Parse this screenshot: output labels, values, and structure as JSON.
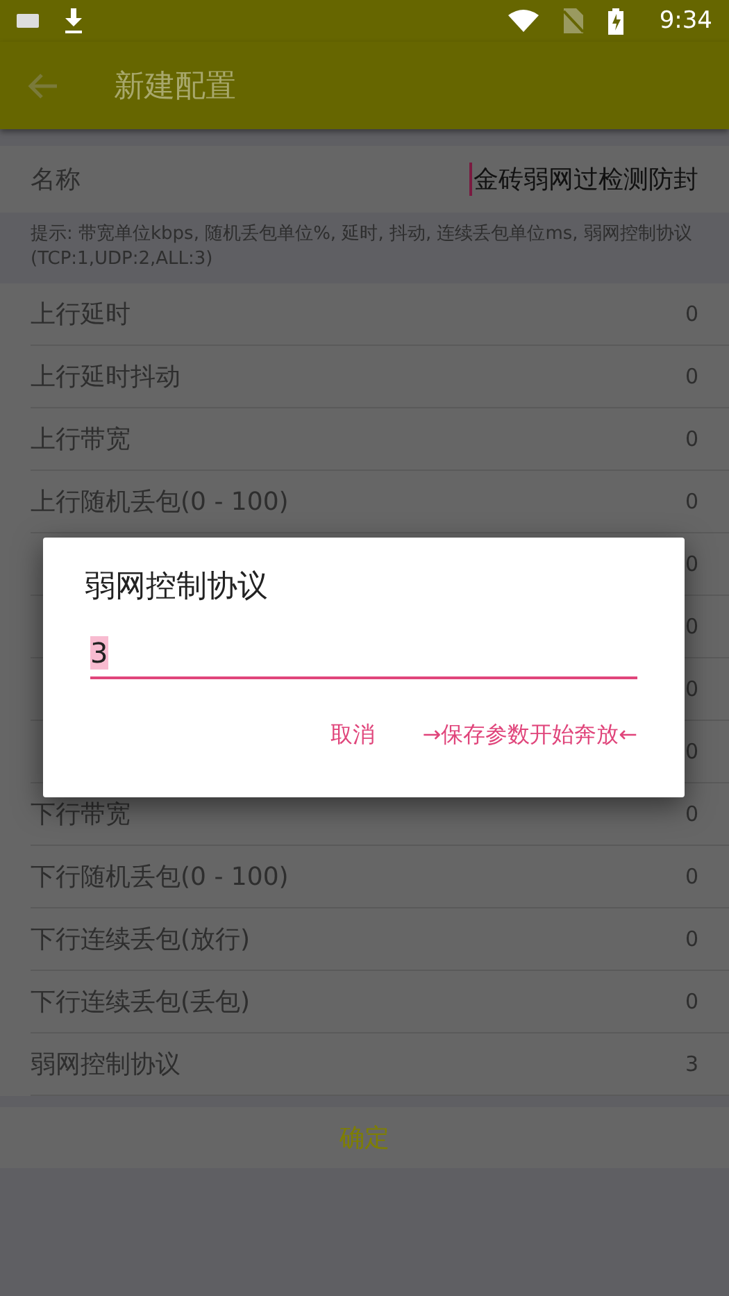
{
  "status_bar": {
    "time": "9:34"
  },
  "app_bar": {
    "title": "新建配置"
  },
  "name_field": {
    "label": "名称",
    "value": "金砖弱网过检测防封"
  },
  "hint": "提示: 带宽单位kbps, 随机丢包单位%, 延时, 抖动, 连续丢包单位ms, 弱网控制协议(TCP:1,UDP:2,ALL:3)",
  "settings": [
    {
      "label": "上行延时",
      "value": "0"
    },
    {
      "label": "上行延时抖动",
      "value": "0"
    },
    {
      "label": "上行带宽",
      "value": "0"
    },
    {
      "label": "上行随机丢包(0 - 100)",
      "value": "0"
    },
    {
      "value": "0"
    },
    {
      "value": "0"
    },
    {
      "value": "0"
    },
    {
      "value": "0"
    },
    {
      "label": "下行带宽",
      "value": "0"
    },
    {
      "label": "下行随机丢包(0 - 100)",
      "value": "0"
    },
    {
      "label": "下行连续丢包(放行)",
      "value": "0"
    },
    {
      "label": "下行连续丢包(丢包)",
      "value": "0"
    },
    {
      "label": "弱网控制协议",
      "value": "3"
    }
  ],
  "confirm_button": "确定",
  "dialog": {
    "title": "弱网控制协议",
    "value": "3",
    "buttons": [
      "取消",
      "→保存参数开始奔放←"
    ]
  }
}
